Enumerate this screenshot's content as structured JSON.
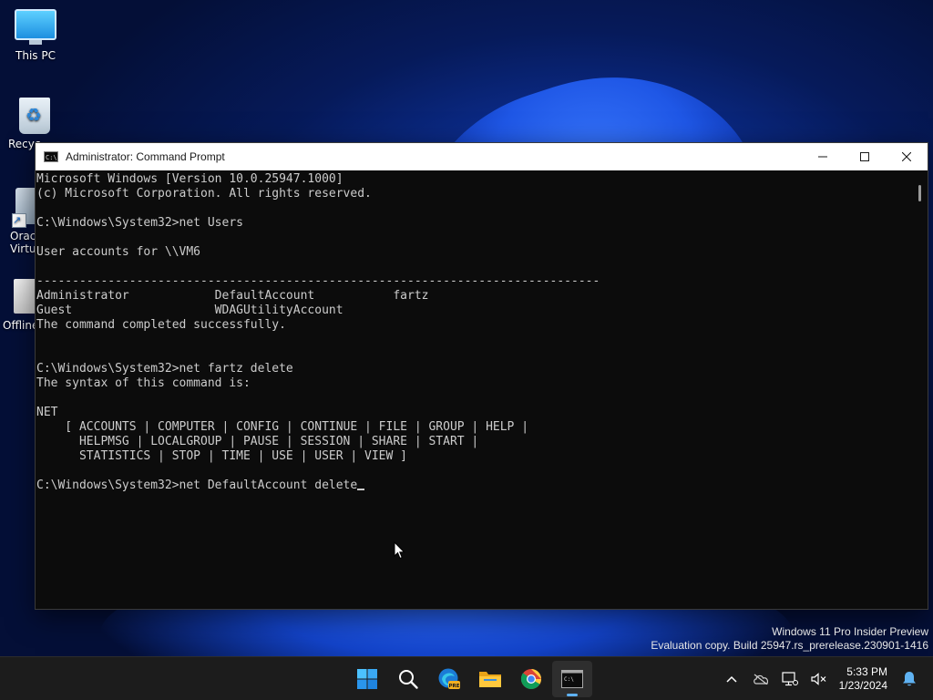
{
  "desktop": {
    "icons": [
      {
        "label": "This PC",
        "icon": "this-pc-icon"
      },
      {
        "label": "Recyc",
        "icon": "recycle-bin-icon"
      },
      {
        "label": "Oracl\nVirtu",
        "icon": "virtualbox-icon"
      },
      {
        "label": "Offline",
        "icon": "offline-file-icon"
      }
    ],
    "icon_line1": [
      "This PC",
      "Recyc",
      "Oracl",
      "Offline"
    ],
    "icon_line2": [
      "",
      "",
      "Virtu",
      ""
    ]
  },
  "window": {
    "title": "Administrator: Command Prompt",
    "controls": [
      "minimize-icon",
      "maximize-icon",
      "close-icon"
    ]
  },
  "console": {
    "lines": [
      "Microsoft Windows [Version 10.0.25947.1000]",
      "(c) Microsoft Corporation. All rights reserved.",
      "",
      "C:\\Windows\\System32>net Users",
      "",
      "User accounts for \\\\VM6",
      "",
      "-------------------------------------------------------------------------------",
      "Administrator            DefaultAccount           fartz",
      "Guest                    WDAGUtilityAccount",
      "The command completed successfully.",
      "",
      "",
      "C:\\Windows\\System32>net fartz delete",
      "The syntax of this command is:",
      "",
      "NET",
      "    [ ACCOUNTS | COMPUTER | CONFIG | CONTINUE | FILE | GROUP | HELP |",
      "      HELPMSG | LOCALGROUP | PAUSE | SESSION | SHARE | START |",
      "      STATISTICS | STOP | TIME | USE | USER | VIEW ]",
      "",
      "C:\\Windows\\System32>net DefaultAccount delete"
    ]
  },
  "watermark": {
    "line1": "Windows 11 Pro Insider Preview",
    "line2": "Evaluation copy. Build 25947.rs_prerelease.230901-1416"
  },
  "taskbar": {
    "apps": [
      "start-icon",
      "search-icon",
      "edge-beta-icon",
      "file-explorer-icon",
      "chrome-icon",
      "command-prompt-icon"
    ],
    "edge_badge": "PRE",
    "tray": [
      "chevron-up-icon",
      "onedrive-icon",
      "network-icon",
      "volume-muted-icon",
      "notification-bell-icon"
    ],
    "time": "5:33 PM",
    "date": "1/23/2024"
  },
  "colors": {
    "console_bg": "#0c0c0c",
    "console_text": "#cccccc",
    "taskbar_bg": "#1c1c1c",
    "accent": "#5fb2f2"
  }
}
